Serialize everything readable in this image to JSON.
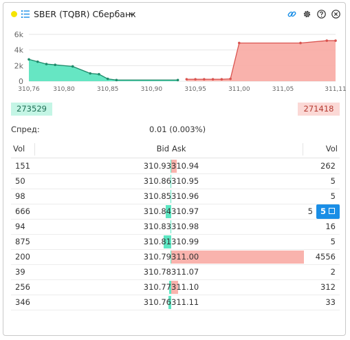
{
  "header": {
    "title": "SBER (TQBR) Сбербанк",
    "icons": [
      "list-icon",
      "chevron-down-icon",
      "link-icon",
      "gear-icon",
      "help-icon",
      "close-icon"
    ]
  },
  "chart_data": {
    "type": "area",
    "x_ticks": [
      "310,76",
      "310,80",
      "310,85",
      "310,90",
      "310,95",
      "311,00",
      "311,05",
      "311,11"
    ],
    "y_ticks": [
      "0",
      "2k",
      "4k",
      "6k"
    ],
    "ylim": [
      0,
      6000
    ],
    "grid": true,
    "series": [
      {
        "color": "#55e3bd",
        "points": [
          [
            310.76,
            2800
          ],
          [
            310.77,
            2500
          ],
          [
            310.78,
            2200
          ],
          [
            310.79,
            2100
          ],
          [
            310.81,
            1900
          ],
          [
            310.83,
            1000
          ],
          [
            310.84,
            900
          ],
          [
            310.85,
            300
          ],
          [
            310.86,
            150
          ],
          [
            310.93,
            150
          ]
        ]
      },
      {
        "color": "#f8aaa3",
        "points": [
          [
            310.94,
            250
          ],
          [
            310.95,
            250
          ],
          [
            310.96,
            250
          ],
          [
            310.97,
            250
          ],
          [
            310.98,
            250
          ],
          [
            310.99,
            300
          ],
          [
            311.0,
            4900
          ],
          [
            311.07,
            4900
          ],
          [
            311.1,
            5200
          ],
          [
            311.11,
            5200
          ]
        ]
      }
    ]
  },
  "totals": {
    "bid": "273529",
    "ask": "271418"
  },
  "spread": {
    "label": "Спред:",
    "value": "0.01 (0.003%)"
  },
  "table": {
    "headers": {
      "vol": "Vol",
      "bid": "Bid",
      "ask": "Ask",
      "ask_vol": "Vol"
    },
    "rows": [
      {
        "vol": "151",
        "bid": "310.93",
        "ask": "310.94",
        "ask_vol": "262",
        "bid_fill": 0.02,
        "ask_fill": 0.04
      },
      {
        "vol": "50",
        "bid": "310.86",
        "ask": "310.95",
        "ask_vol": "5",
        "bid_fill": 0.01,
        "ask_fill": 0.0
      },
      {
        "vol": "98",
        "bid": "310.85",
        "ask": "310.96",
        "ask_vol": "5",
        "bid_fill": 0.015,
        "ask_fill": 0.0
      },
      {
        "vol": "666",
        "bid": "310.84",
        "ask": "310.97",
        "ask_vol": "5",
        "bid_fill": 0.13,
        "ask_fill": 0.0
      },
      {
        "vol": "94",
        "bid": "310.83",
        "ask": "310.98",
        "ask_vol": "16",
        "bid_fill": 0.015,
        "ask_fill": 0.0
      },
      {
        "vol": "875",
        "bid": "310.81",
        "ask": "310.99",
        "ask_vol": "5",
        "bid_fill": 0.19,
        "ask_fill": 0.0
      },
      {
        "vol": "200",
        "bid": "310.79",
        "ask": "311.00",
        "ask_vol": "4556",
        "bid_fill": 0.02,
        "ask_fill": 1.0
      },
      {
        "vol": "39",
        "bid": "310.78",
        "ask": "311.07",
        "ask_vol": "2",
        "bid_fill": 0.0,
        "ask_fill": 0.0
      },
      {
        "vol": "256",
        "bid": "310.77",
        "ask": "311.10",
        "ask_vol": "312",
        "bid_fill": 0.05,
        "ask_fill": 0.05
      },
      {
        "vol": "346",
        "bid": "310.76",
        "ask": "311.11",
        "ask_vol": "33",
        "bid_fill": 0.07,
        "ask_fill": 0.0
      }
    ],
    "quick_order": {
      "row": 3,
      "value": "5",
      "button_label": "5"
    }
  }
}
